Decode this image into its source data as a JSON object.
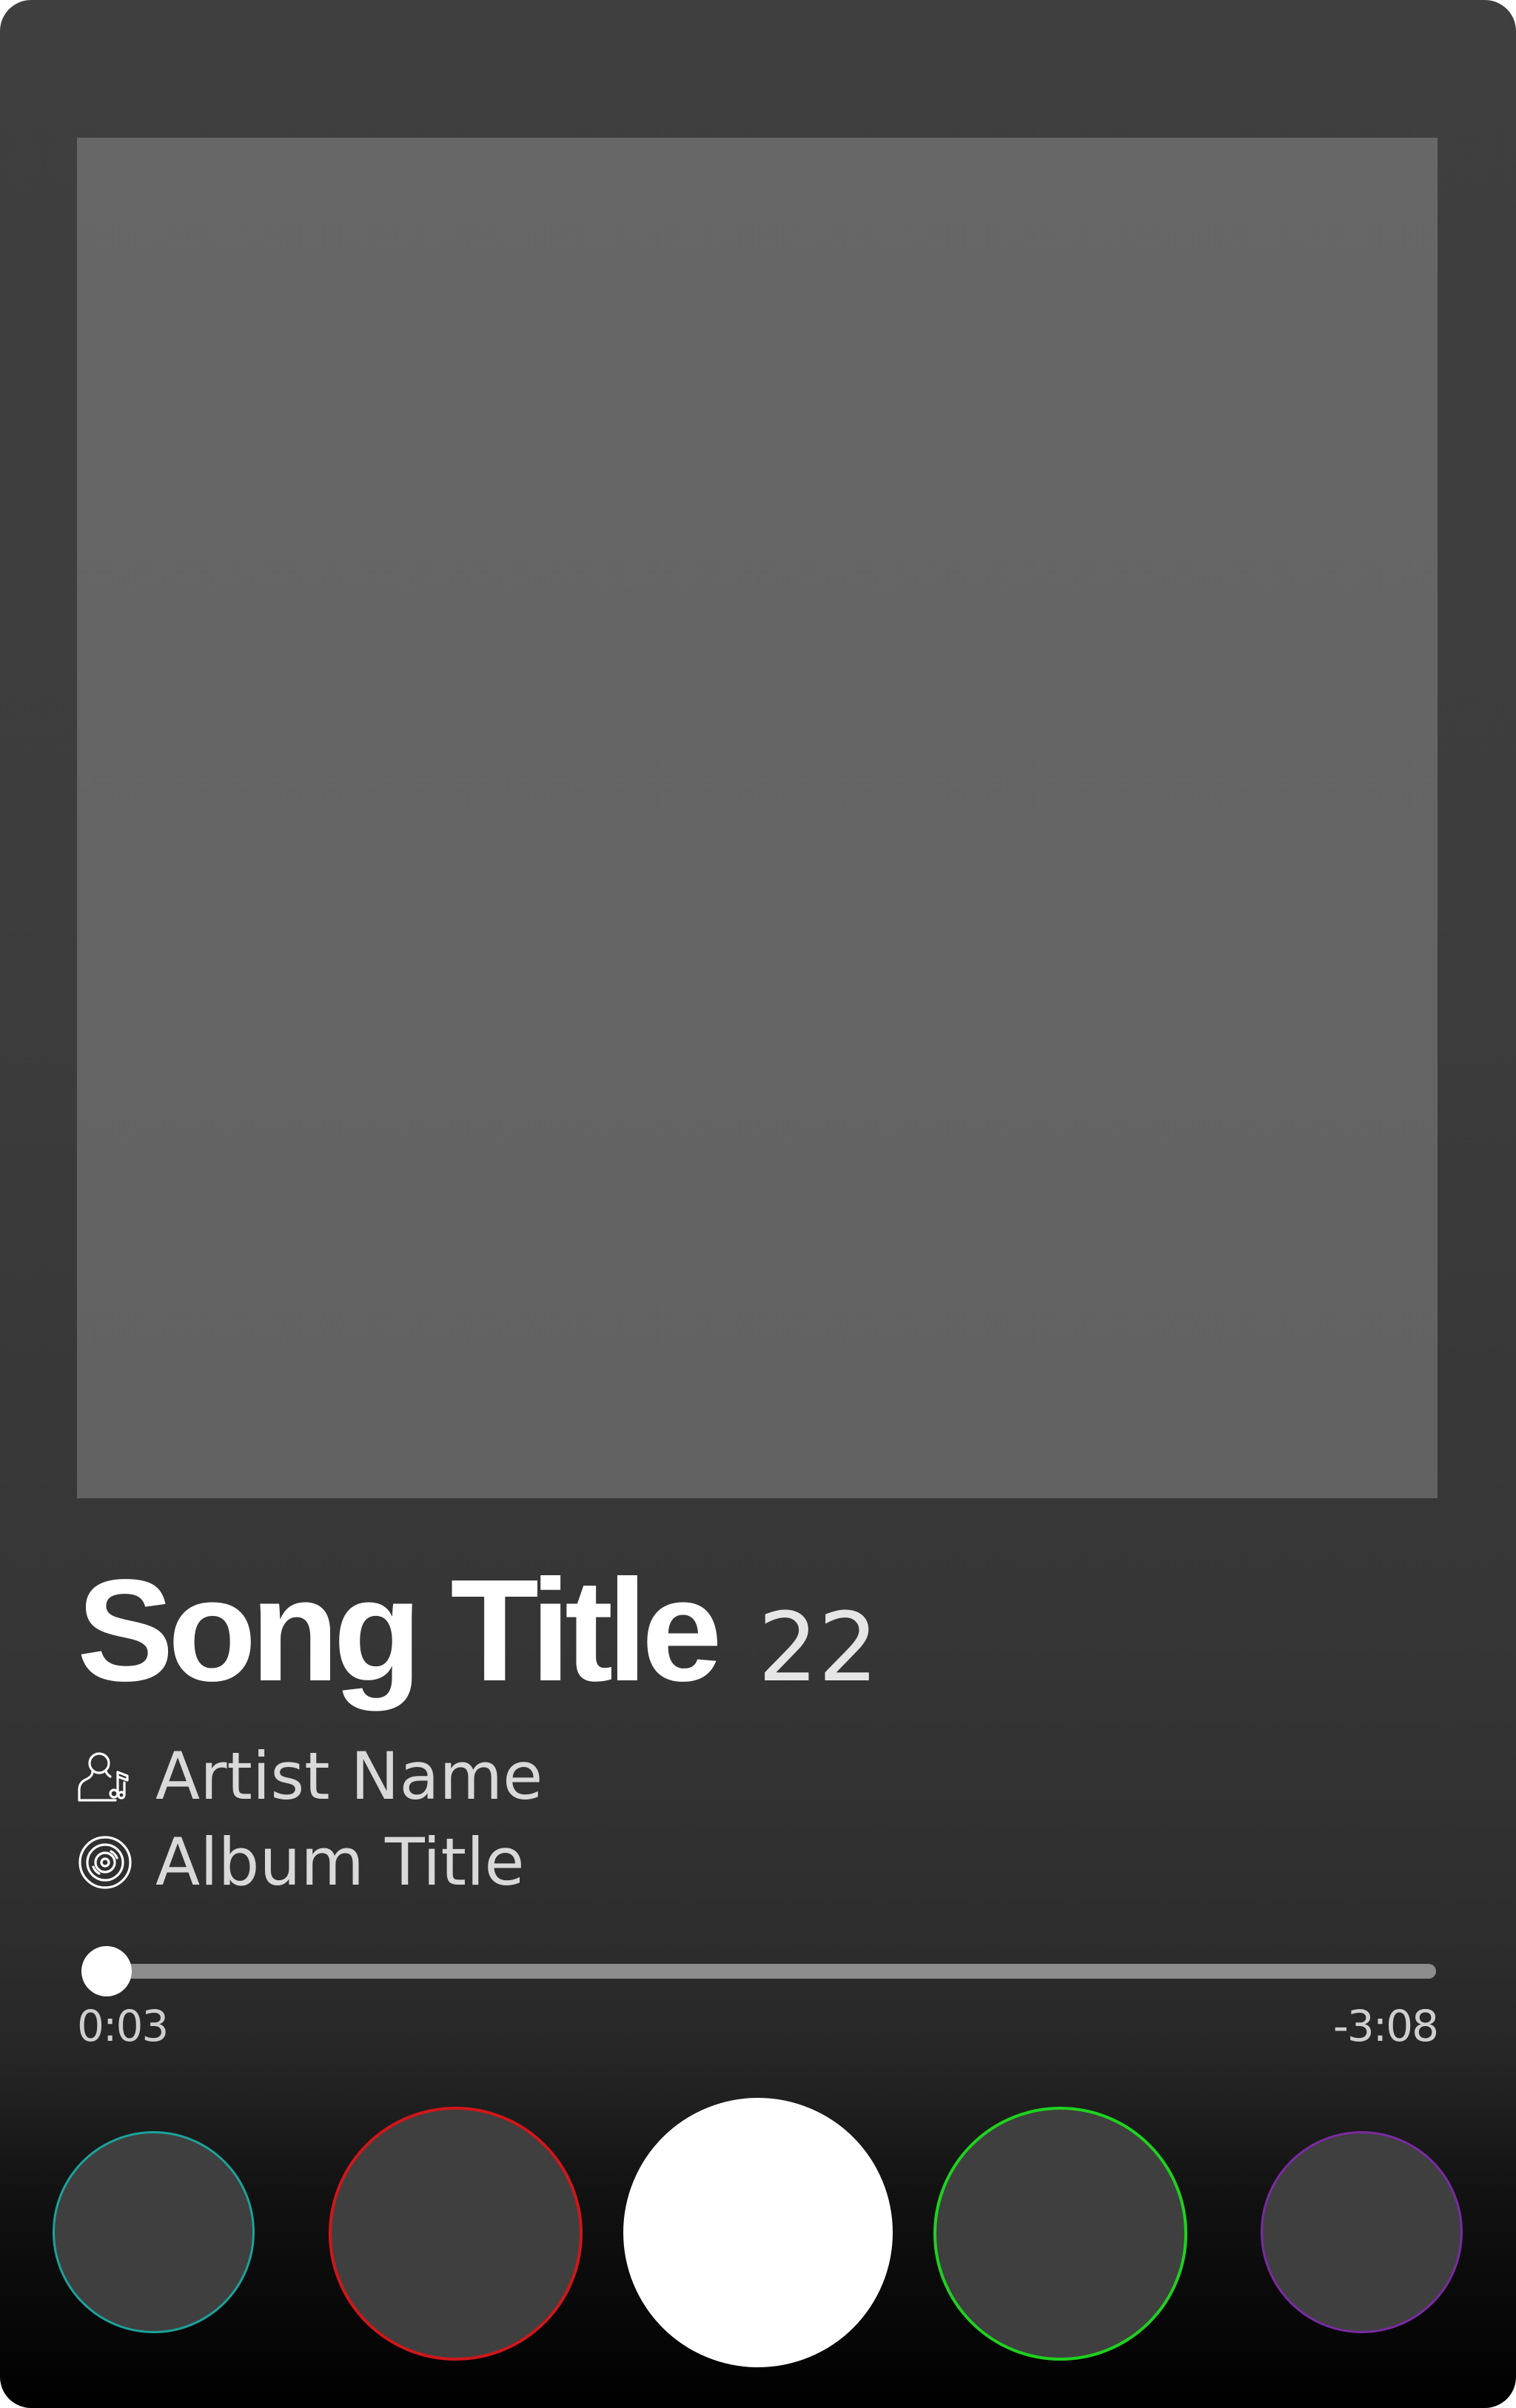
{
  "track": {
    "title": "Song Title",
    "number": "22",
    "artist": "Artist Name",
    "album": "Album Title"
  },
  "playback": {
    "elapsed": "0:03",
    "remaining": "-3:08",
    "progress_fraction": 0.012
  },
  "icons": {
    "artist": "artist-person-music-icon",
    "album": "vinyl-disc-icon"
  },
  "controls": [
    {
      "name": "control-circle-1",
      "ring_color": "#1aa39a"
    },
    {
      "name": "control-circle-2",
      "ring_color": "#d0161a"
    },
    {
      "name": "control-circle-3",
      "fill_color": "#ffffff"
    },
    {
      "name": "control-circle-4",
      "ring_color": "#1ed21e"
    },
    {
      "name": "control-circle-5",
      "ring_color": "#7a2aa3"
    }
  ],
  "colors": {
    "artwork_placeholder": "#666666",
    "card_top": "#3f3f3f",
    "card_bottom": "#000000",
    "progress_track": "#8c8c8c",
    "progress_fill": "#ffffff"
  }
}
